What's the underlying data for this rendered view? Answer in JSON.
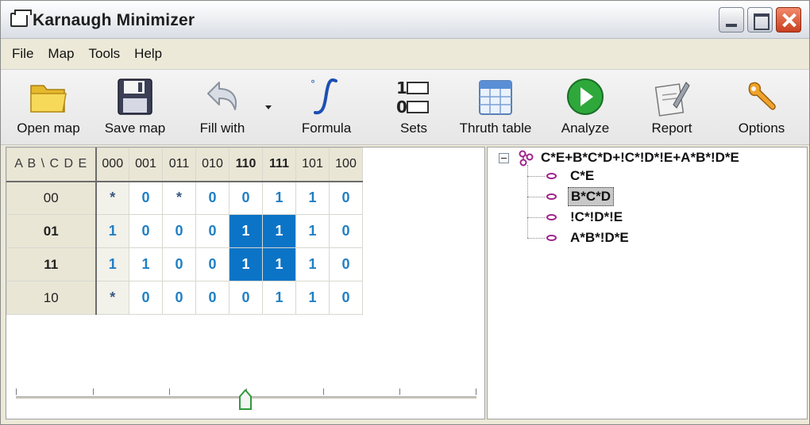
{
  "window": {
    "title": "Karnaugh Minimizer"
  },
  "menu": [
    "File",
    "Map",
    "Tools",
    "Help"
  ],
  "toolbar": [
    {
      "label": "Open map",
      "icon": "folder-icon"
    },
    {
      "label": "Save map",
      "icon": "floppy-disk-icon"
    },
    {
      "label": "Fill with",
      "icon": "undo-arrow-icon"
    },
    {
      "label": "Formula",
      "icon": "integral-icon"
    },
    {
      "label": "Sets",
      "icon": "sets-icon"
    },
    {
      "label": "Thruth table",
      "icon": "calendar-table-icon"
    },
    {
      "label": "Analyze",
      "icon": "play-icon"
    },
    {
      "label": "Report",
      "icon": "report-icon"
    },
    {
      "label": "Options",
      "icon": "wrench-icon"
    }
  ],
  "kmap": {
    "corner": "A B \\ C D E",
    "columns": [
      "000",
      "001",
      "011",
      "010",
      "110",
      "111",
      "101",
      "100"
    ],
    "bold_columns": [
      4,
      5
    ],
    "rows": [
      {
        "label": "00",
        "bold": false,
        "cells": [
          "*",
          "0",
          "*",
          "0",
          "0",
          "1",
          "1",
          "0"
        ]
      },
      {
        "label": "01",
        "bold": true,
        "cells": [
          "1",
          "0",
          "0",
          "0",
          "1",
          "1",
          "1",
          "0"
        ]
      },
      {
        "label": "11",
        "bold": true,
        "cells": [
          "1",
          "1",
          "0",
          "0",
          "1",
          "1",
          "1",
          "0"
        ]
      },
      {
        "label": "10",
        "bold": false,
        "cells": [
          "*",
          "0",
          "0",
          "0",
          "0",
          "1",
          "1",
          "0"
        ]
      }
    ],
    "selected": [
      [
        1,
        4
      ],
      [
        1,
        5
      ],
      [
        2,
        4
      ],
      [
        2,
        5
      ]
    ]
  },
  "slider": {
    "ticks": 7,
    "position": 0.5
  },
  "tree": {
    "root": "C*E+B*C*D+!C*!D*!E+A*B*!D*E",
    "children": [
      {
        "label": "C*E",
        "selected": false
      },
      {
        "label": "B*C*D",
        "selected": true
      },
      {
        "label": "!C*!D*!E",
        "selected": false
      },
      {
        "label": "A*B*!D*E",
        "selected": false
      }
    ]
  },
  "colors": {
    "selection": "#0b74c6",
    "cell_text": "#1f7fc4",
    "leaf_icon": "#a0248c"
  }
}
